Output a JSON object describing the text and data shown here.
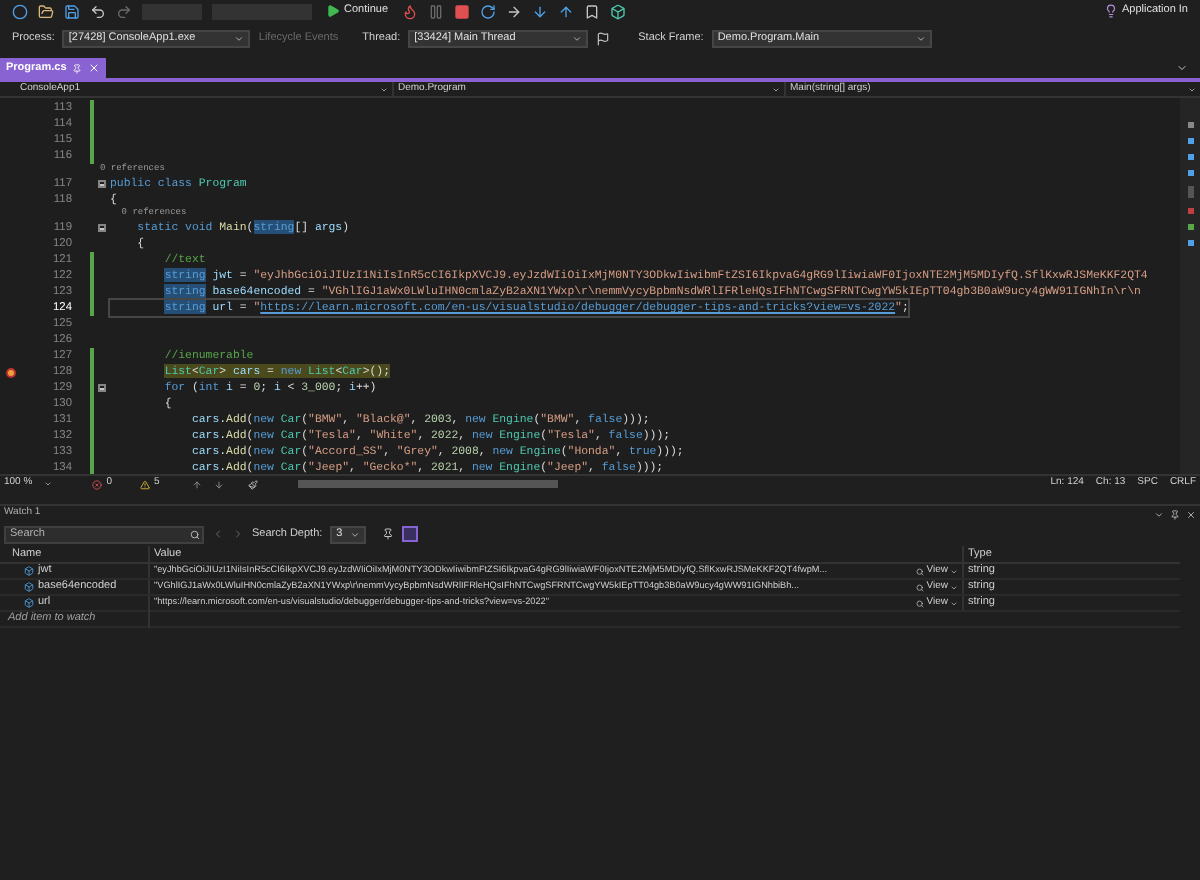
{
  "toolbar": {
    "continue_label": "Continue",
    "insights_label": "Application In"
  },
  "debug_location": {
    "process_label": "Process:",
    "process": "[27428] ConsoleApp1.exe",
    "lifecycle_label": "Lifecycle Events",
    "lifecycle_disabled": true,
    "thread_label": "Thread:",
    "thread": "[33424] Main Thread",
    "stack_frame_label": "Stack Frame:",
    "stack_frame": "Demo.Program.Main"
  },
  "tabs": [
    {
      "label": "Program.cs",
      "selected": true
    }
  ],
  "navigation": {
    "project": "ConsoleApp1",
    "type": "Demo.Program",
    "member": "Main(string[] args)"
  },
  "editor": {
    "lines": [
      {
        "kind": "code",
        "number": "113",
        "changed": true,
        "current": false,
        "executing": false,
        "foldable": false
      },
      {
        "kind": "code",
        "number": "114",
        "changed": true,
        "current": false,
        "executing": false,
        "foldable": false
      },
      {
        "kind": "code",
        "number": "115",
        "changed": true,
        "current": false,
        "executing": false,
        "foldable": false
      },
      {
        "kind": "code",
        "number": "116",
        "changed": true,
        "current": false,
        "executing": false,
        "foldable": false
      },
      {
        "kind": "lens",
        "text": "0 references"
      },
      {
        "kind": "code",
        "number": "117",
        "changed": false,
        "current": false,
        "executing": false,
        "foldable": true,
        "segments": [
          {
            "kind": "kw",
            "text": "public class "
          },
          {
            "kind": "ty",
            "text": "Program"
          }
        ]
      },
      {
        "kind": "code",
        "number": "118",
        "changed": false,
        "current": false,
        "executing": false,
        "foldable": false,
        "segments": [
          {
            "kind": "p",
            "text": "{"
          }
        ]
      },
      {
        "kind": "lens",
        "text": "    0 references"
      },
      {
        "kind": "code",
        "number": "119",
        "changed": false,
        "current": false,
        "executing": false,
        "foldable": true,
        "segments": [
          {
            "kind": "kw",
            "text": "    static void "
          },
          {
            "kind": "fn",
            "text": "Main"
          },
          {
            "kind": "p",
            "text": "("
          },
          {
            "kind": "hl",
            "text": "string"
          },
          {
            "kind": "p",
            "text": "[] "
          },
          {
            "kind": "prm",
            "text": "args"
          },
          {
            "kind": "p",
            "text": ")"
          }
        ]
      },
      {
        "kind": "code",
        "number": "120",
        "changed": false,
        "current": false,
        "executing": false,
        "foldable": false,
        "segments": [
          {
            "kind": "p",
            "text": "    {"
          }
        ]
      },
      {
        "kind": "code",
        "number": "121",
        "changed": true,
        "current": false,
        "executing": false,
        "foldable": false,
        "segments": [
          {
            "kind": "cm",
            "text": "        //text"
          }
        ]
      },
      {
        "kind": "code",
        "number": "122",
        "changed": true,
        "current": false,
        "executing": false,
        "foldable": false,
        "segments": [
          {
            "kind": "hl",
            "text": "        string"
          },
          {
            "kind": "prm",
            "text": " jwt"
          },
          {
            "kind": "p",
            "text": " = "
          },
          {
            "kind": "str",
            "text": "\"eyJhbGciOiJIUzI1NiIsInR5cCI6IkpXVCJ9.eyJzdWIiOiIxMjM0NTY3ODkwIiwibmFtZSI6IkpvaG4gRG9lIiwiaWF0IjoxNTE2MjM5MDIyfQ.SflKxwRJSMeKKF2QT4"
          }
        ]
      },
      {
        "kind": "code",
        "number": "123",
        "changed": true,
        "current": false,
        "executing": false,
        "foldable": false,
        "segments": [
          {
            "kind": "hl",
            "text": "        string"
          },
          {
            "kind": "prm",
            "text": " base64encoded"
          },
          {
            "kind": "p",
            "text": " = "
          },
          {
            "kind": "str",
            "text": "\"VGhlIGJ1aWx0LWluIHN0cmlaZyB2aXN1YWxp\\r\\nemmVycyBpbmNsdWRlIFRleHQsIFhNTCwgSFRNTCwgYW5kIEpTT04gb3B0aW9ucy4gWW91IGNhIn\\r\\n"
          }
        ]
      },
      {
        "kind": "code",
        "number": "124",
        "changed": true,
        "current": true,
        "executing": false,
        "foldable": false,
        "segments": [
          {
            "kind": "hl",
            "text": "        string"
          },
          {
            "kind": "prm",
            "text": " url"
          },
          {
            "kind": "p",
            "text": " = "
          },
          {
            "kind": "str",
            "text": "\""
          },
          {
            "kind": "url",
            "text": "https://learn.microsoft.com/en-us/visualstudio/debugger/debugger-tips-and-tricks?view=vs-2022"
          },
          {
            "kind": "str",
            "text": "\""
          },
          {
            "kind": "p",
            "text": ";"
          }
        ]
      },
      {
        "kind": "code",
        "number": "125",
        "changed": false,
        "current": false,
        "executing": false,
        "foldable": false
      },
      {
        "kind": "code",
        "number": "126",
        "changed": false,
        "current": false,
        "executing": false,
        "foldable": false
      },
      {
        "kind": "code",
        "number": "127",
        "changed": true,
        "current": false,
        "executing": false,
        "foldable": false,
        "segments": [
          {
            "kind": "cm",
            "text": "        //ienumerable"
          }
        ]
      },
      {
        "kind": "code",
        "number": "128",
        "changed": true,
        "current": false,
        "executing": true,
        "foldable": false,
        "segments": [
          {
            "kind": "ty",
            "text": "        List"
          },
          {
            "kind": "p",
            "text": "<"
          },
          {
            "kind": "ty",
            "text": "Car"
          },
          {
            "kind": "p",
            "text": "> "
          },
          {
            "kind": "prm",
            "text": "cars"
          },
          {
            "kind": "p",
            "text": " = "
          },
          {
            "kind": "kw",
            "text": "new "
          },
          {
            "kind": "ty",
            "text": "List"
          },
          {
            "kind": "p",
            "text": "<"
          },
          {
            "kind": "ty",
            "text": "Car"
          },
          {
            "kind": "p",
            "text": ">();"
          }
        ]
      },
      {
        "kind": "code",
        "number": "129",
        "changed": true,
        "current": false,
        "executing": false,
        "foldable": true,
        "segments": [
          {
            "kind": "kw",
            "text": "        for"
          },
          {
            "kind": "p",
            "text": " ("
          },
          {
            "kind": "kw",
            "text": "int "
          },
          {
            "kind": "prm",
            "text": "i"
          },
          {
            "kind": "p",
            "text": " = "
          },
          {
            "kind": "num",
            "text": "0"
          },
          {
            "kind": "p",
            "text": "; "
          },
          {
            "kind": "prm",
            "text": "i"
          },
          {
            "kind": "p",
            "text": " < "
          },
          {
            "kind": "num",
            "text": "3_000"
          },
          {
            "kind": "p",
            "text": "; "
          },
          {
            "kind": "prm",
            "text": "i"
          },
          {
            "kind": "p",
            "text": "++)"
          }
        ]
      },
      {
        "kind": "code",
        "number": "130",
        "changed": true,
        "current": false,
        "executing": false,
        "foldable": false,
        "segments": [
          {
            "kind": "p",
            "text": "        {"
          }
        ]
      },
      {
        "kind": "code",
        "number": "131",
        "changed": true,
        "current": false,
        "executing": false,
        "foldable": false,
        "segments": [
          {
            "kind": "prm",
            "text": "            cars"
          },
          {
            "kind": "p",
            "text": "."
          },
          {
            "kind": "fn",
            "text": "Add"
          },
          {
            "kind": "p",
            "text": "("
          },
          {
            "kind": "kw",
            "text": "new "
          },
          {
            "kind": "ty",
            "text": "Car"
          },
          {
            "kind": "p",
            "text": "("
          },
          {
            "kind": "str",
            "text": "\"BMW\""
          },
          {
            "kind": "p",
            "text": ", "
          },
          {
            "kind": "str",
            "text": "\"Black@\""
          },
          {
            "kind": "p",
            "text": ", "
          },
          {
            "kind": "num",
            "text": "2003"
          },
          {
            "kind": "p",
            "text": ", "
          },
          {
            "kind": "kw",
            "text": "new "
          },
          {
            "kind": "ty",
            "text": "Engine"
          },
          {
            "kind": "p",
            "text": "("
          },
          {
            "kind": "str",
            "text": "\"BMW\""
          },
          {
            "kind": "p",
            "text": ", "
          },
          {
            "kind": "kw",
            "text": "false"
          },
          {
            "kind": "p",
            "text": ")));"
          }
        ]
      },
      {
        "kind": "code",
        "number": "132",
        "changed": true,
        "current": false,
        "executing": false,
        "foldable": false,
        "segments": [
          {
            "kind": "prm",
            "text": "            cars"
          },
          {
            "kind": "p",
            "text": "."
          },
          {
            "kind": "fn",
            "text": "Add"
          },
          {
            "kind": "p",
            "text": "("
          },
          {
            "kind": "kw",
            "text": "new "
          },
          {
            "kind": "ty",
            "text": "Car"
          },
          {
            "kind": "p",
            "text": "("
          },
          {
            "kind": "str",
            "text": "\"Tesla\""
          },
          {
            "kind": "p",
            "text": ", "
          },
          {
            "kind": "str",
            "text": "\"White\""
          },
          {
            "kind": "p",
            "text": ", "
          },
          {
            "kind": "num",
            "text": "2022"
          },
          {
            "kind": "p",
            "text": ", "
          },
          {
            "kind": "kw",
            "text": "new "
          },
          {
            "kind": "ty",
            "text": "Engine"
          },
          {
            "kind": "p",
            "text": "("
          },
          {
            "kind": "str",
            "text": "\"Tesla\""
          },
          {
            "kind": "p",
            "text": ", "
          },
          {
            "kind": "kw",
            "text": "false"
          },
          {
            "kind": "p",
            "text": ")));"
          }
        ]
      },
      {
        "kind": "code",
        "number": "133",
        "changed": true,
        "current": false,
        "executing": false,
        "foldable": false,
        "segments": [
          {
            "kind": "prm",
            "text": "            cars"
          },
          {
            "kind": "p",
            "text": "."
          },
          {
            "kind": "fn",
            "text": "Add"
          },
          {
            "kind": "p",
            "text": "("
          },
          {
            "kind": "kw",
            "text": "new "
          },
          {
            "kind": "ty",
            "text": "Car"
          },
          {
            "kind": "p",
            "text": "("
          },
          {
            "kind": "str",
            "text": "\"Accord_SS\""
          },
          {
            "kind": "p",
            "text": ", "
          },
          {
            "kind": "str",
            "text": "\"Grey\""
          },
          {
            "kind": "p",
            "text": ", "
          },
          {
            "kind": "num",
            "text": "2008"
          },
          {
            "kind": "p",
            "text": ", "
          },
          {
            "kind": "kw",
            "text": "new "
          },
          {
            "kind": "ty",
            "text": "Engine"
          },
          {
            "kind": "p",
            "text": "("
          },
          {
            "kind": "str",
            "text": "\"Honda\""
          },
          {
            "kind": "p",
            "text": ", "
          },
          {
            "kind": "kw",
            "text": "true"
          },
          {
            "kind": "p",
            "text": ")));"
          }
        ]
      },
      {
        "kind": "code",
        "number": "134",
        "changed": true,
        "current": false,
        "executing": false,
        "foldable": false,
        "segments": [
          {
            "kind": "prm",
            "text": "            cars"
          },
          {
            "kind": "p",
            "text": "."
          },
          {
            "kind": "fn",
            "text": "Add"
          },
          {
            "kind": "p",
            "text": "("
          },
          {
            "kind": "kw",
            "text": "new "
          },
          {
            "kind": "ty",
            "text": "Car"
          },
          {
            "kind": "p",
            "text": "("
          },
          {
            "kind": "str",
            "text": "\"Jeep\""
          },
          {
            "kind": "p",
            "text": ", "
          },
          {
            "kind": "str",
            "text": "\"Gecko*\""
          },
          {
            "kind": "p",
            "text": ", "
          },
          {
            "kind": "num",
            "text": "2021"
          },
          {
            "kind": "p",
            "text": ", "
          },
          {
            "kind": "kw",
            "text": "new "
          },
          {
            "kind": "ty",
            "text": "Engine"
          },
          {
            "kind": "p",
            "text": "("
          },
          {
            "kind": "str",
            "text": "\"Jeep\""
          },
          {
            "kind": "p",
            "text": ", "
          },
          {
            "kind": "kw",
            "text": "false"
          },
          {
            "kind": "p",
            "text": ")));"
          }
        ]
      }
    ]
  },
  "status_bar": {
    "zoom": "100 %",
    "errors": "0",
    "warnings": "5",
    "line": "Ln: 124",
    "column": "Ch: 13",
    "indent": "SPC",
    "line_ending": "CRLF"
  },
  "watch": {
    "title": "Watch 1",
    "search": {
      "placeholder": "Search"
    },
    "search_depth_label": "Search Depth:",
    "search_depth": "3",
    "columns": [
      "Name",
      "Value",
      "Type"
    ],
    "rows": [
      {
        "name": "jwt",
        "value": "\"eyJhbGciOiJIUzI1NiIsInR5cCI6IkpXVCJ9.eyJzdWIiOiIxMjM0NTY3ODkwIiwibmFtZSI6IkpvaG4gRG9lIiwiaWF0IjoxNTE2MjM5MDIyfQ.SflKxwRJSMeKKF2QT4fwpM...",
        "view_label": "View",
        "type": "string"
      },
      {
        "name": "base64encoded",
        "value": "\"VGhlIGJ1aWx0LWluIHN0cmlaZyB2aXN1YWxp\\r\\nemmVycyBpbmNsdWRlIFRleHQsIFhNTCwgSFRNTCwgYW5kIEpTT04gb3B0aW9ucy4gWW91IGNhbiBh...",
        "view_label": "View",
        "type": "string"
      },
      {
        "name": "url",
        "value": "\"https://learn.microsoft.com/en-us/visualstudio/debugger/debugger-tips-and-tricks?view=vs-2022\"",
        "view_label": "View",
        "type": "string"
      }
    ],
    "add_item_placeholder": "Add item to watch"
  }
}
